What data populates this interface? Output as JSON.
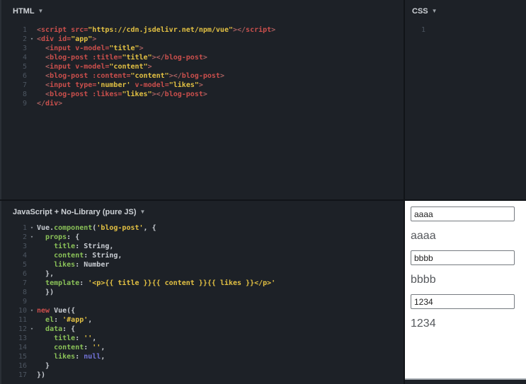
{
  "icons": {
    "dropdown": "▼",
    "fold": "▾"
  },
  "colors": {
    "panel_bg": "#1d2127",
    "divider": "#111418",
    "tag_red": "#cb4f4c",
    "string_yellow": "#e3c143",
    "property_green": "#8ac158",
    "null_blue": "#7373d9",
    "line_number_gray": "#4c5560",
    "result_bg": "#ffffff",
    "result_text": "#55585c"
  },
  "panels": {
    "html": {
      "title": "HTML",
      "lines": [
        {
          "n": 1,
          "fold": false,
          "tokens": [
            [
              "punc",
              "<"
            ],
            [
              "tag",
              "script"
            ],
            [
              "plain",
              " "
            ],
            [
              "attr",
              "src"
            ],
            [
              "op",
              "="
            ],
            [
              "str",
              "\"https://cdn.jsdelivr.net/npm/vue\""
            ],
            [
              "punc",
              "></"
            ],
            [
              "tag",
              "script"
            ],
            [
              "punc",
              ">"
            ]
          ]
        },
        {
          "n": 2,
          "fold": true,
          "tokens": [
            [
              "punc",
              "<"
            ],
            [
              "tag",
              "div"
            ],
            [
              "plain",
              " "
            ],
            [
              "attr",
              "id"
            ],
            [
              "op",
              "="
            ],
            [
              "str",
              "\"app\""
            ],
            [
              "punc",
              ">"
            ]
          ]
        },
        {
          "n": 3,
          "fold": false,
          "tokens": [
            [
              "plain",
              "  "
            ],
            [
              "punc",
              "<"
            ],
            [
              "tag",
              "input"
            ],
            [
              "plain",
              " "
            ],
            [
              "attr",
              "v-model"
            ],
            [
              "op",
              "="
            ],
            [
              "str",
              "\"title\""
            ],
            [
              "punc",
              ">"
            ]
          ]
        },
        {
          "n": 4,
          "fold": false,
          "tokens": [
            [
              "plain",
              "  "
            ],
            [
              "punc",
              "<"
            ],
            [
              "tag",
              "blog-post"
            ],
            [
              "plain",
              " "
            ],
            [
              "attr",
              ":title"
            ],
            [
              "op",
              "="
            ],
            [
              "str",
              "\"title\""
            ],
            [
              "punc",
              "></"
            ],
            [
              "tag",
              "blog-post"
            ],
            [
              "punc",
              ">"
            ]
          ]
        },
        {
          "n": 5,
          "fold": false,
          "tokens": [
            [
              "plain",
              "  "
            ],
            [
              "punc",
              "<"
            ],
            [
              "tag",
              "input"
            ],
            [
              "plain",
              " "
            ],
            [
              "attr",
              "v-model"
            ],
            [
              "op",
              "="
            ],
            [
              "str",
              "\"content\""
            ],
            [
              "punc",
              ">"
            ]
          ]
        },
        {
          "n": 6,
          "fold": false,
          "tokens": [
            [
              "plain",
              "  "
            ],
            [
              "punc",
              "<"
            ],
            [
              "tag",
              "blog-post"
            ],
            [
              "plain",
              " "
            ],
            [
              "attr",
              ":content"
            ],
            [
              "op",
              "="
            ],
            [
              "str",
              "\"content\""
            ],
            [
              "punc",
              "></"
            ],
            [
              "tag",
              "blog-post"
            ],
            [
              "punc",
              ">"
            ]
          ]
        },
        {
          "n": 7,
          "fold": false,
          "tokens": [
            [
              "plain",
              "  "
            ],
            [
              "punc",
              "<"
            ],
            [
              "tag",
              "input"
            ],
            [
              "plain",
              " "
            ],
            [
              "attr",
              "type"
            ],
            [
              "op",
              "="
            ],
            [
              "str",
              "'number'"
            ],
            [
              "plain",
              " "
            ],
            [
              "attr",
              "v-model"
            ],
            [
              "op",
              "="
            ],
            [
              "str",
              "\"likes\""
            ],
            [
              "punc",
              ">"
            ]
          ]
        },
        {
          "n": 8,
          "fold": false,
          "tokens": [
            [
              "plain",
              "  "
            ],
            [
              "punc",
              "<"
            ],
            [
              "tag",
              "blog-post"
            ],
            [
              "plain",
              " "
            ],
            [
              "attr",
              ":likes"
            ],
            [
              "op",
              "="
            ],
            [
              "str",
              "\"likes\""
            ],
            [
              "punc",
              "></"
            ],
            [
              "tag",
              "blog-post"
            ],
            [
              "punc",
              ">"
            ]
          ]
        },
        {
          "n": 9,
          "fold": false,
          "tokens": [
            [
              "punc",
              "</"
            ],
            [
              "tag",
              "div"
            ],
            [
              "punc",
              ">"
            ]
          ]
        }
      ]
    },
    "css": {
      "title": "CSS",
      "lines": [
        {
          "n": 1,
          "fold": false,
          "tokens": []
        }
      ]
    },
    "js": {
      "title": "JavaScript + No-Library (pure JS)",
      "lines": [
        {
          "n": 1,
          "fold": true,
          "tokens": [
            [
              "plain",
              "Vue"
            ],
            [
              "jpunc",
              "."
            ],
            [
              "fn",
              "component"
            ],
            [
              "jpunc",
              "("
            ],
            [
              "str",
              "'blog-post'"
            ],
            [
              "jpunc",
              ", {"
            ]
          ]
        },
        {
          "n": 2,
          "fold": true,
          "tokens": [
            [
              "plain",
              "  "
            ],
            [
              "prop",
              "props"
            ],
            [
              "jpunc",
              ": {"
            ]
          ]
        },
        {
          "n": 3,
          "fold": false,
          "tokens": [
            [
              "plain",
              "    "
            ],
            [
              "prop",
              "title"
            ],
            [
              "jpunc",
              ": "
            ],
            [
              "type",
              "String"
            ],
            [
              "jpunc",
              ","
            ]
          ]
        },
        {
          "n": 4,
          "fold": false,
          "tokens": [
            [
              "plain",
              "    "
            ],
            [
              "prop",
              "content"
            ],
            [
              "jpunc",
              ": "
            ],
            [
              "type",
              "String"
            ],
            [
              "jpunc",
              ","
            ]
          ]
        },
        {
          "n": 5,
          "fold": false,
          "tokens": [
            [
              "plain",
              "    "
            ],
            [
              "prop",
              "likes"
            ],
            [
              "jpunc",
              ": "
            ],
            [
              "type",
              "Number"
            ]
          ]
        },
        {
          "n": 6,
          "fold": false,
          "tokens": [
            [
              "plain",
              "  "
            ],
            [
              "jpunc",
              "},"
            ]
          ]
        },
        {
          "n": 7,
          "fold": false,
          "tokens": [
            [
              "plain",
              "  "
            ],
            [
              "prop",
              "template"
            ],
            [
              "jpunc",
              ": "
            ],
            [
              "str",
              "'<p>{{ title }}{{ content }}{{ likes }}</p>'"
            ]
          ]
        },
        {
          "n": 8,
          "fold": false,
          "tokens": [
            [
              "plain",
              "  "
            ],
            [
              "jpunc",
              "})"
            ]
          ]
        },
        {
          "n": 9,
          "fold": false,
          "tokens": []
        },
        {
          "n": 10,
          "fold": true,
          "tokens": [
            [
              "kw",
              "new"
            ],
            [
              "plain",
              " Vue"
            ],
            [
              "jpunc",
              "({"
            ]
          ]
        },
        {
          "n": 11,
          "fold": false,
          "tokens": [
            [
              "plain",
              "  "
            ],
            [
              "prop",
              "el"
            ],
            [
              "jpunc",
              ": "
            ],
            [
              "str",
              "'#app'"
            ],
            [
              "jpunc",
              ","
            ]
          ]
        },
        {
          "n": 12,
          "fold": true,
          "tokens": [
            [
              "plain",
              "  "
            ],
            [
              "prop",
              "data"
            ],
            [
              "jpunc",
              ": {"
            ]
          ]
        },
        {
          "n": 13,
          "fold": false,
          "tokens": [
            [
              "plain",
              "    "
            ],
            [
              "prop",
              "title"
            ],
            [
              "jpunc",
              ": "
            ],
            [
              "str",
              "''"
            ],
            [
              "jpunc",
              ","
            ]
          ]
        },
        {
          "n": 14,
          "fold": false,
          "tokens": [
            [
              "plain",
              "    "
            ],
            [
              "prop",
              "content"
            ],
            [
              "jpunc",
              ": "
            ],
            [
              "str",
              "''"
            ],
            [
              "jpunc",
              ","
            ]
          ]
        },
        {
          "n": 15,
          "fold": false,
          "tokens": [
            [
              "plain",
              "    "
            ],
            [
              "prop",
              "likes"
            ],
            [
              "jpunc",
              ": "
            ],
            [
              "nul",
              "null"
            ],
            [
              "jpunc",
              ","
            ]
          ]
        },
        {
          "n": 16,
          "fold": false,
          "tokens": [
            [
              "plain",
              "  "
            ],
            [
              "jpunc",
              "}"
            ]
          ]
        },
        {
          "n": 17,
          "fold": false,
          "tokens": [
            [
              "jpunc",
              "})"
            ]
          ]
        }
      ]
    },
    "result": {
      "items": [
        {
          "kind": "input",
          "value": "aaaa"
        },
        {
          "kind": "text",
          "text": "aaaa"
        },
        {
          "kind": "input",
          "value": "bbbb"
        },
        {
          "kind": "text",
          "text": "bbbb"
        },
        {
          "kind": "input",
          "value": "1234"
        },
        {
          "kind": "text",
          "text": "1234"
        }
      ]
    }
  }
}
